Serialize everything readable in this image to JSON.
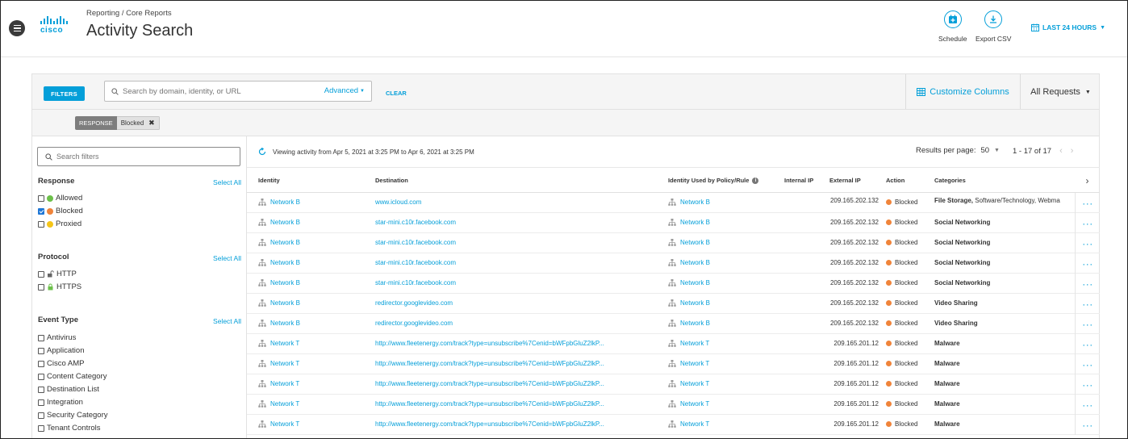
{
  "header": {
    "breadcrumb": "Reporting / Core Reports",
    "title": "Activity Search",
    "logo_text": "cisco",
    "schedule_label": "Schedule",
    "export_label": "Export CSV",
    "time_range": "LAST 24 HOURS"
  },
  "filterbar": {
    "filters_label": "FILTERS",
    "search_placeholder": "Search by domain, identity, or URL",
    "advanced_label": "Advanced",
    "clear_label": "CLEAR",
    "customize_label": "Customize Columns",
    "all_requests_label": "All Requests"
  },
  "chip": {
    "key": "RESPONSE",
    "value": "Blocked"
  },
  "sidebar": {
    "search_placeholder": "Search filters",
    "select_all": "Select All",
    "response": {
      "title": "Response",
      "options": [
        {
          "label": "Allowed",
          "checked": false,
          "color": "#6cc04a"
        },
        {
          "label": "Blocked",
          "checked": true,
          "color": "#f0843a"
        },
        {
          "label": "Proxied",
          "checked": false,
          "color": "#f5c518"
        }
      ]
    },
    "protocol": {
      "title": "Protocol",
      "options": [
        {
          "label": "HTTP"
        },
        {
          "label": "HTTPS"
        }
      ]
    },
    "event_type": {
      "title": "Event Type",
      "options": [
        {
          "label": "Antivirus"
        },
        {
          "label": "Application"
        },
        {
          "label": "Cisco AMP"
        },
        {
          "label": "Content Category"
        },
        {
          "label": "Destination List"
        },
        {
          "label": "Integration"
        },
        {
          "label": "Security Category"
        },
        {
          "label": "Tenant Controls"
        }
      ]
    }
  },
  "results": {
    "viewing_text": "Viewing activity from Apr 5, 2021 at 3:25 PM to Apr 6, 2021 at 3:25 PM",
    "results_per_page_label": "Results per page:",
    "results_per_page": "50",
    "range": "1 - 17 of 17",
    "columns": {
      "identity": "Identity",
      "destination": "Destination",
      "policy": "Identity Used by Policy/Rule",
      "internal_ip": "Internal IP",
      "external_ip": "External IP",
      "action": "Action",
      "categories": "Categories"
    },
    "rows": [
      {
        "identity": "Network B",
        "destination": "www.icloud.com",
        "policy": "Network B",
        "external_ip": "209.165.202.132",
        "action": "Blocked",
        "cat_bold": "File Storage,",
        "cat_rest": " Software/Technology, Webma"
      },
      {
        "identity": "Network B",
        "destination": "star-mini.c10r.facebook.com",
        "policy": "Network B",
        "external_ip": "209.165.202.132",
        "action": "Blocked",
        "cat_bold": "Social Networking",
        "cat_rest": ""
      },
      {
        "identity": "Network B",
        "destination": "star-mini.c10r.facebook.com",
        "policy": "Network B",
        "external_ip": "209.165.202.132",
        "action": "Blocked",
        "cat_bold": "Social Networking",
        "cat_rest": ""
      },
      {
        "identity": "Network B",
        "destination": "star-mini.c10r.facebook.com",
        "policy": "Network B",
        "external_ip": "209.165.202.132",
        "action": "Blocked",
        "cat_bold": "Social Networking",
        "cat_rest": ""
      },
      {
        "identity": "Network B",
        "destination": "star-mini.c10r.facebook.com",
        "policy": "Network B",
        "external_ip": "209.165.202.132",
        "action": "Blocked",
        "cat_bold": "Social Networking",
        "cat_rest": ""
      },
      {
        "identity": "Network B",
        "destination": "redirector.googlevideo.com",
        "policy": "Network B",
        "external_ip": "209.165.202.132",
        "action": "Blocked",
        "cat_bold": "Video Sharing",
        "cat_rest": ""
      },
      {
        "identity": "Network B",
        "destination": "redirector.googlevideo.com",
        "policy": "Network B",
        "external_ip": "209.165.202.132",
        "action": "Blocked",
        "cat_bold": "Video Sharing",
        "cat_rest": ""
      },
      {
        "identity": "Network T",
        "destination": "http://www.fleetenergy.com/track?type=unsubscribe%7Cenid=bWFpbGluZ2lkP...",
        "policy": "Network T",
        "external_ip": "209.165.201.12",
        "action": "Blocked",
        "cat_bold": "Malware",
        "cat_rest": ""
      },
      {
        "identity": "Network T",
        "destination": "http://www.fleetenergy.com/track?type=unsubscribe%7Cenid=bWFpbGluZ2lkP...",
        "policy": "Network T",
        "external_ip": "209.165.201.12",
        "action": "Blocked",
        "cat_bold": "Malware",
        "cat_rest": ""
      },
      {
        "identity": "Network T",
        "destination": "http://www.fleetenergy.com/track?type=unsubscribe%7Cenid=bWFpbGluZ2lkP...",
        "policy": "Network T",
        "external_ip": "209.165.201.12",
        "action": "Blocked",
        "cat_bold": "Malware",
        "cat_rest": ""
      },
      {
        "identity": "Network T",
        "destination": "http://www.fleetenergy.com/track?type=unsubscribe%7Cenid=bWFpbGluZ2lkP...",
        "policy": "Network T",
        "external_ip": "209.165.201.12",
        "action": "Blocked",
        "cat_bold": "Malware",
        "cat_rest": ""
      },
      {
        "identity": "Network T",
        "destination": "http://www.fleetenergy.com/track?type=unsubscribe%7Cenid=bWFpbGluZ2lkP...",
        "policy": "Network T",
        "external_ip": "209.165.201.12",
        "action": "Blocked",
        "cat_bold": "Malware",
        "cat_rest": ""
      }
    ]
  },
  "colors": {
    "accent": "#049fd9",
    "blocked": "#f0843a"
  }
}
